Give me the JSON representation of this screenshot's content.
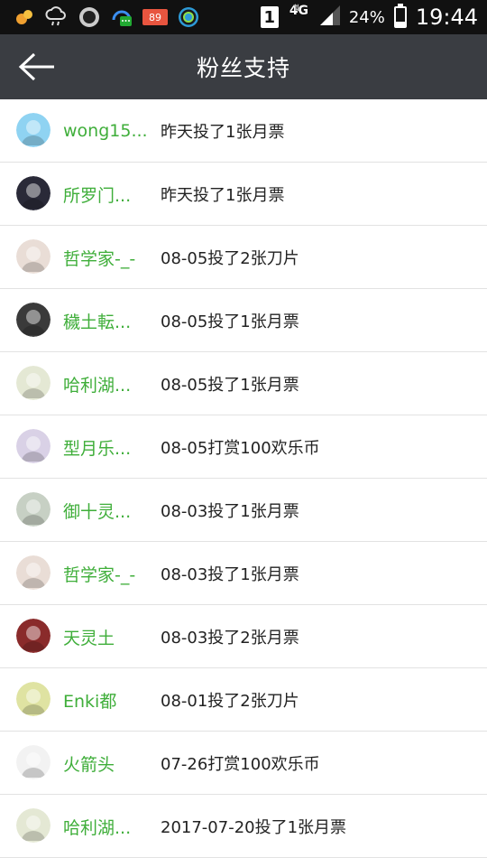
{
  "status_bar": {
    "notification_badge": "89",
    "sim": "1",
    "network": "4G",
    "battery_percent": "24%",
    "battery_level": 0.24,
    "time": "19:44"
  },
  "header": {
    "title": "粉丝支持"
  },
  "supporters": [
    {
      "name": "wong15...",
      "action": "昨天投了1张月票",
      "avatar_color": "#8fd3f2"
    },
    {
      "name": "所罗门...",
      "action": "昨天投了1张月票",
      "avatar_color": "#2a2a38"
    },
    {
      "name": "哲学家-_-",
      "action": "08-05投了2张刀片",
      "avatar_color": "#e9ddd6"
    },
    {
      "name": "穢土転...",
      "action": "08-05投了1张月票",
      "avatar_color": "#3a3a3a"
    },
    {
      "name": "哈利湖...",
      "action": "08-05投了1张月票",
      "avatar_color": "#e4e8d4"
    },
    {
      "name": "型月乐...",
      "action": "08-05打赏100欢乐币",
      "avatar_color": "#d9d1e6"
    },
    {
      "name": "御十灵...",
      "action": "08-03投了1张月票",
      "avatar_color": "#c7d0c4"
    },
    {
      "name": "哲学家-_-",
      "action": "08-03投了1张月票",
      "avatar_color": "#e9ddd6"
    },
    {
      "name": "天灵土",
      "action": "08-03投了2张月票",
      "avatar_color": "#8a2b2b"
    },
    {
      "name": "Enki都",
      "action": "08-01投了2张刀片",
      "avatar_color": "#dfe3a2"
    },
    {
      "name": "火箭头",
      "action": "07-26打赏100欢乐币",
      "avatar_color": "#f2f2f2"
    },
    {
      "name": "哈利湖...",
      "action": "2017-07-20投了1张月票",
      "avatar_color": "#e4e8d4"
    }
  ]
}
